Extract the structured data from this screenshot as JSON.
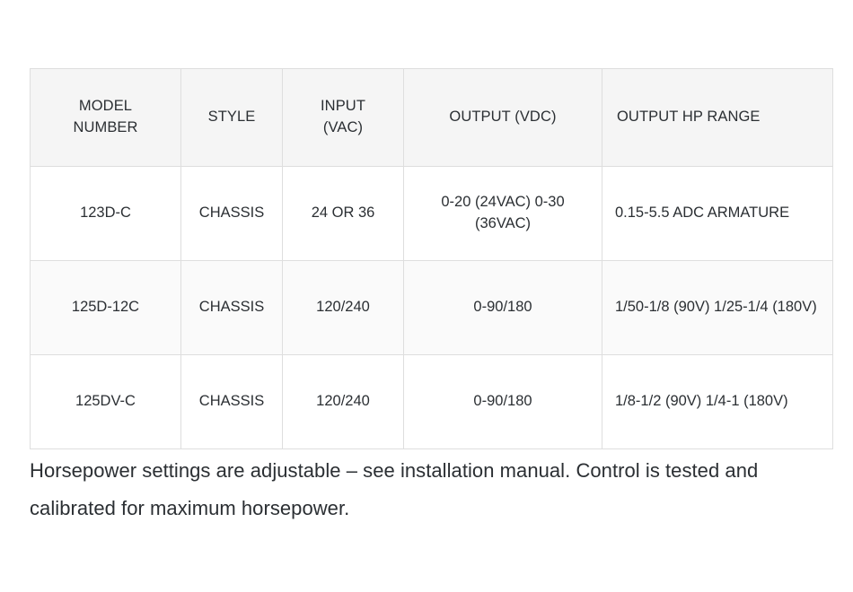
{
  "table": {
    "columns": [
      "MODEL NUMBER",
      "STYLE",
      "INPUT (VAC)",
      "OUTPUT (VDC)",
      "OUTPUT HP RANGE"
    ],
    "column_lines": {
      "col0_line1": "MODEL",
      "col0_line2": "NUMBER",
      "col1_line1": "STYLE",
      "col2_line1": "INPUT",
      "col2_line2": "(VAC)",
      "col3_line1": "OUTPUT (VDC)",
      "col4_line1": "OUTPUT HP RANGE"
    },
    "rows": [
      {
        "model_number": "123D-C",
        "style": "CHASSIS",
        "input_vac": "24 OR 36",
        "output_vdc": "0-20 (24VAC) 0-30 (36VAC)",
        "output_hp_range": "0.15-5.5 ADC ARMATURE"
      },
      {
        "model_number": "125D-12C",
        "style": "CHASSIS",
        "input_vac": "120/240",
        "output_vdc": "0-90/180",
        "output_hp_range": "1/50-1/8 (90V) 1/25-1/4 (180V)"
      },
      {
        "model_number": "125DV-C",
        "style": "CHASSIS",
        "input_vac": "120/240",
        "output_vdc": "0-90/180",
        "output_hp_range": "1/8-1/2 (90V) 1/4-1 (180V)"
      }
    ]
  },
  "note": {
    "text": "Horsepower settings are adjustable – see installation manual. Control is tested and calibrated for maximum horsepower."
  },
  "colors": {
    "text": "#2b2f33",
    "border": "#dedede",
    "header_background": "#f5f5f5",
    "row_odd_background": "#ffffff",
    "row_even_background": "#fafafa",
    "page_background": "#ffffff"
  }
}
